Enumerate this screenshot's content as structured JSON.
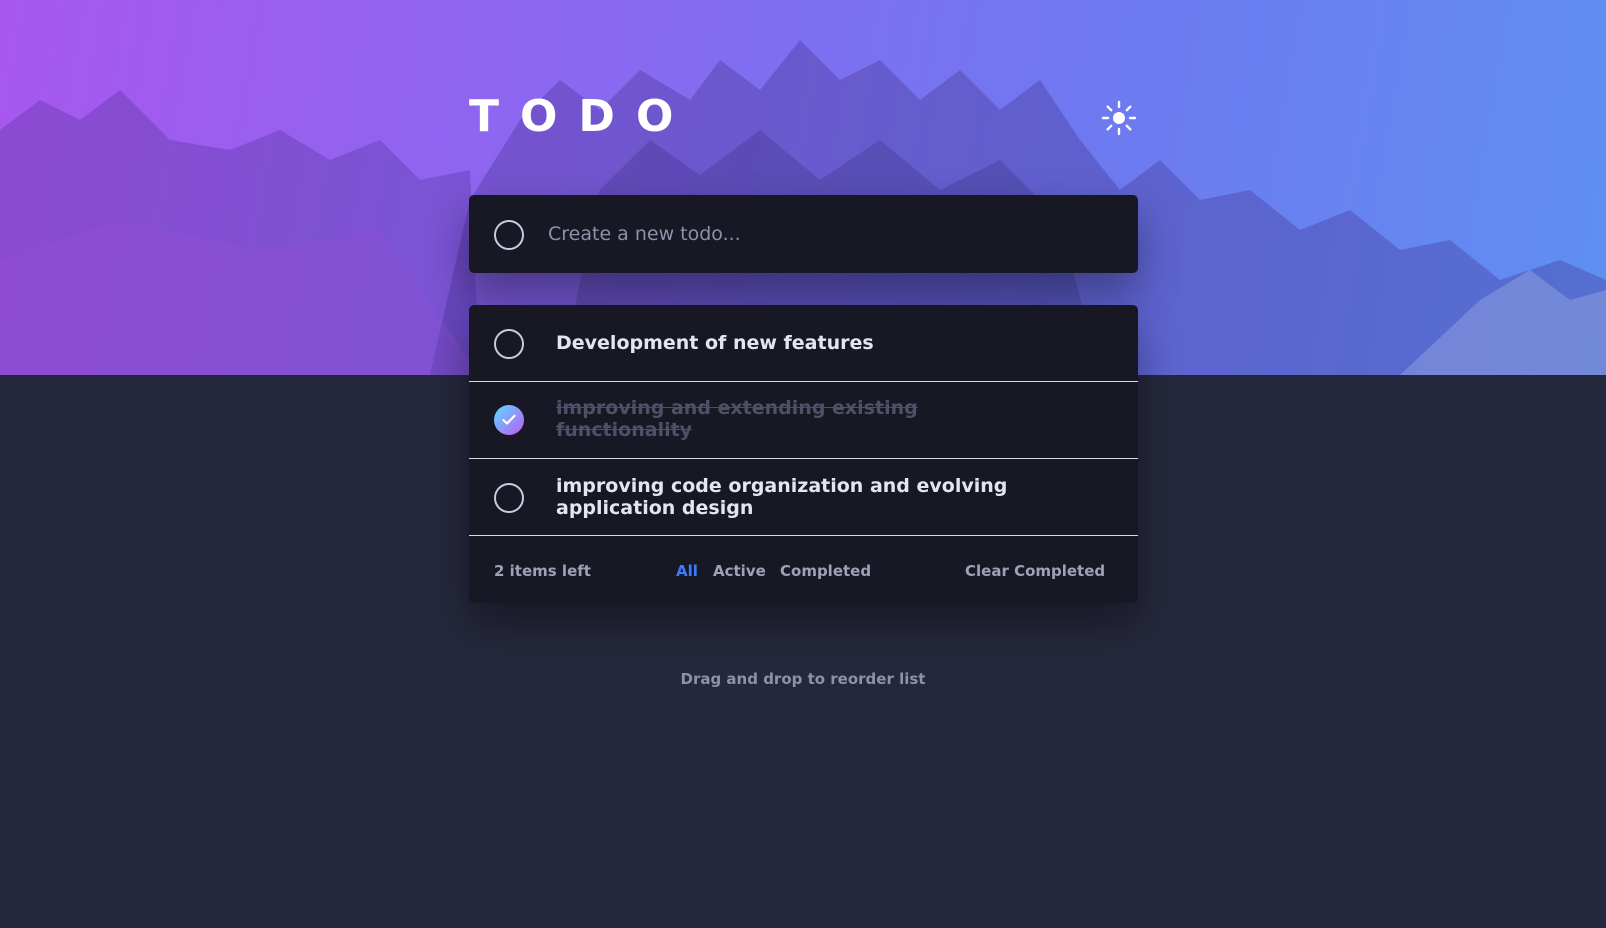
{
  "header": {
    "title": "TODO",
    "theme_icon": "sun-icon"
  },
  "new_todo": {
    "placeholder": "Create a new todo...",
    "value": ""
  },
  "todos": [
    {
      "text": "Development of new features",
      "completed": false
    },
    {
      "text": "improving and extending existing functionality",
      "completed": true
    },
    {
      "text": "improving code organization and evolving application design",
      "completed": false
    }
  ],
  "footer": {
    "items_left": "2 items left",
    "filters": [
      {
        "label": "All",
        "active": true
      },
      {
        "label": "Active",
        "active": false
      },
      {
        "label": "Completed",
        "active": false
      }
    ],
    "clear_completed": "Clear Completed"
  },
  "hint": "Drag and drop to reorder list",
  "colors": {
    "background": "#25273c",
    "panel": "#181824",
    "active_filter": "#3a7bfd",
    "check_gradient_start": "#57ddff",
    "check_gradient_end": "#c058f3"
  }
}
